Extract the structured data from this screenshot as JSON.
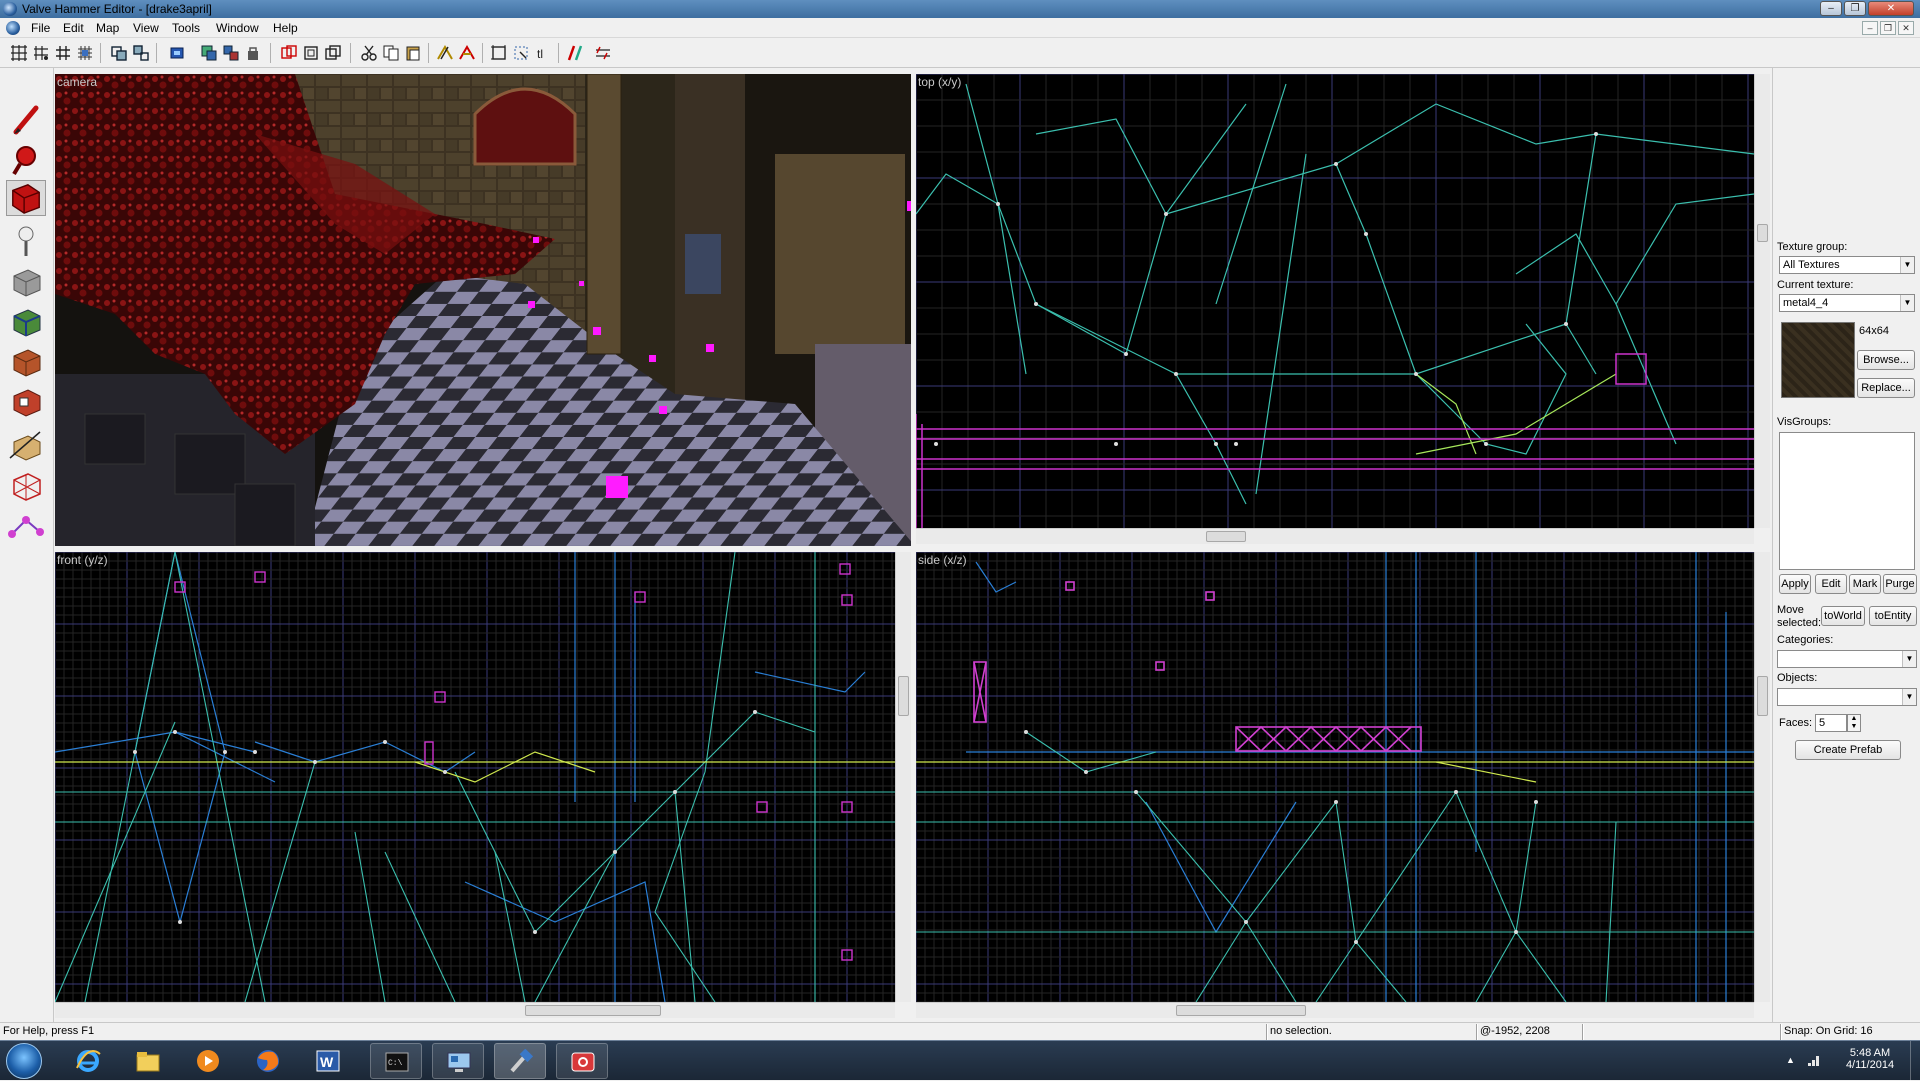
{
  "window": {
    "title": "Valve Hammer Editor - [drake3april]"
  },
  "menu": {
    "items": [
      "File",
      "Edit",
      "Map",
      "View",
      "Tools",
      "Window",
      "Help"
    ]
  },
  "toolbar": {
    "icons": [
      "grid-icon",
      "grid-dots-icon",
      "grid-hash-icon",
      "grid-small-icon",
      "group-icon",
      "ungroup-icon",
      "hide-icon",
      "select-icon",
      "selection-mode-icon",
      "texture-lock-icon",
      "carve-icon",
      "hollow-icon",
      "clip-icon",
      "cut-icon",
      "copy-icon",
      "paste-icon",
      "wireframe-icon",
      "flat-icon",
      "box-icon",
      "select-object-icon",
      "toggle-texture-icon",
      "run-map-icon",
      "options-icon"
    ]
  },
  "palette": {
    "tools": [
      "selection-tool-icon",
      "magnify-tool-icon",
      "camera-tool-icon",
      "entity-tool-icon",
      "block-tool-icon",
      "texture-application-icon",
      "apply-texture-icon",
      "decal-tool-icon",
      "clipping-tool-icon",
      "vertex-manipulation-icon",
      "path-tool-icon"
    ]
  },
  "viewports": {
    "camera": "camera",
    "top": "top (x/y)",
    "front": "front (y/z)",
    "side": "side (x/z)"
  },
  "texture_panel": {
    "group_label": "Texture group:",
    "group_value": "All Textures",
    "current_label": "Current texture:",
    "current_value": "metal4_4",
    "size": "64x64",
    "browse": "Browse...",
    "replace": "Replace..."
  },
  "visgroups": {
    "label": "VisGroups:",
    "apply": "Apply",
    "edit": "Edit",
    "mark": "Mark",
    "purge": "Purge"
  },
  "move": {
    "label_line1": "Move",
    "label_line2": "selected:",
    "to_world": "toWorld",
    "to_entity": "toEntity"
  },
  "prefab": {
    "categories_label": "Categories:",
    "objects_label": "Objects:",
    "faces_label": "Faces:",
    "faces_value": "5",
    "create": "Create Prefab"
  },
  "status": {
    "help": "For Help, press F1",
    "selection": "no selection.",
    "coords": "@-1952, 2208",
    "snap": "Snap: On Grid: 16"
  },
  "clock": {
    "time": "5:48 AM",
    "date": "4/11/2014"
  },
  "taskbar": {
    "apps": [
      "internet-explorer-icon",
      "file-explorer-icon",
      "media-player-icon",
      "firefox-icon",
      "word-icon",
      "command-prompt-icon",
      "remote-desktop-icon",
      "hammer-editor-icon",
      "screenshot-tool-icon"
    ]
  }
}
